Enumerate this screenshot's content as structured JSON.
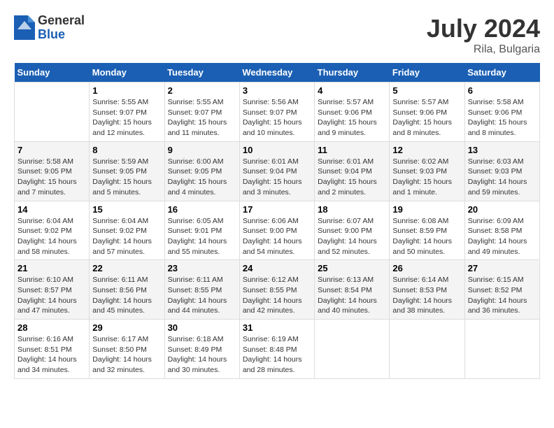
{
  "header": {
    "logo_general": "General",
    "logo_blue": "Blue",
    "month_year": "July 2024",
    "location": "Rila, Bulgaria"
  },
  "days_of_week": [
    "Sunday",
    "Monday",
    "Tuesday",
    "Wednesday",
    "Thursday",
    "Friday",
    "Saturday"
  ],
  "weeks": [
    [
      {
        "day": "",
        "info": ""
      },
      {
        "day": "1",
        "info": "Sunrise: 5:55 AM\nSunset: 9:07 PM\nDaylight: 15 hours\nand 12 minutes."
      },
      {
        "day": "2",
        "info": "Sunrise: 5:55 AM\nSunset: 9:07 PM\nDaylight: 15 hours\nand 11 minutes."
      },
      {
        "day": "3",
        "info": "Sunrise: 5:56 AM\nSunset: 9:07 PM\nDaylight: 15 hours\nand 10 minutes."
      },
      {
        "day": "4",
        "info": "Sunrise: 5:57 AM\nSunset: 9:06 PM\nDaylight: 15 hours\nand 9 minutes."
      },
      {
        "day": "5",
        "info": "Sunrise: 5:57 AM\nSunset: 9:06 PM\nDaylight: 15 hours\nand 8 minutes."
      },
      {
        "day": "6",
        "info": "Sunrise: 5:58 AM\nSunset: 9:06 PM\nDaylight: 15 hours\nand 8 minutes."
      }
    ],
    [
      {
        "day": "7",
        "info": "Sunrise: 5:58 AM\nSunset: 9:05 PM\nDaylight: 15 hours\nand 7 minutes."
      },
      {
        "day": "8",
        "info": "Sunrise: 5:59 AM\nSunset: 9:05 PM\nDaylight: 15 hours\nand 5 minutes."
      },
      {
        "day": "9",
        "info": "Sunrise: 6:00 AM\nSunset: 9:05 PM\nDaylight: 15 hours\nand 4 minutes."
      },
      {
        "day": "10",
        "info": "Sunrise: 6:01 AM\nSunset: 9:04 PM\nDaylight: 15 hours\nand 3 minutes."
      },
      {
        "day": "11",
        "info": "Sunrise: 6:01 AM\nSunset: 9:04 PM\nDaylight: 15 hours\nand 2 minutes."
      },
      {
        "day": "12",
        "info": "Sunrise: 6:02 AM\nSunset: 9:03 PM\nDaylight: 15 hours\nand 1 minute."
      },
      {
        "day": "13",
        "info": "Sunrise: 6:03 AM\nSunset: 9:03 PM\nDaylight: 14 hours\nand 59 minutes."
      }
    ],
    [
      {
        "day": "14",
        "info": "Sunrise: 6:04 AM\nSunset: 9:02 PM\nDaylight: 14 hours\nand 58 minutes."
      },
      {
        "day": "15",
        "info": "Sunrise: 6:04 AM\nSunset: 9:02 PM\nDaylight: 14 hours\nand 57 minutes."
      },
      {
        "day": "16",
        "info": "Sunrise: 6:05 AM\nSunset: 9:01 PM\nDaylight: 14 hours\nand 55 minutes."
      },
      {
        "day": "17",
        "info": "Sunrise: 6:06 AM\nSunset: 9:00 PM\nDaylight: 14 hours\nand 54 minutes."
      },
      {
        "day": "18",
        "info": "Sunrise: 6:07 AM\nSunset: 9:00 PM\nDaylight: 14 hours\nand 52 minutes."
      },
      {
        "day": "19",
        "info": "Sunrise: 6:08 AM\nSunset: 8:59 PM\nDaylight: 14 hours\nand 50 minutes."
      },
      {
        "day": "20",
        "info": "Sunrise: 6:09 AM\nSunset: 8:58 PM\nDaylight: 14 hours\nand 49 minutes."
      }
    ],
    [
      {
        "day": "21",
        "info": "Sunrise: 6:10 AM\nSunset: 8:57 PM\nDaylight: 14 hours\nand 47 minutes."
      },
      {
        "day": "22",
        "info": "Sunrise: 6:11 AM\nSunset: 8:56 PM\nDaylight: 14 hours\nand 45 minutes."
      },
      {
        "day": "23",
        "info": "Sunrise: 6:11 AM\nSunset: 8:55 PM\nDaylight: 14 hours\nand 44 minutes."
      },
      {
        "day": "24",
        "info": "Sunrise: 6:12 AM\nSunset: 8:55 PM\nDaylight: 14 hours\nand 42 minutes."
      },
      {
        "day": "25",
        "info": "Sunrise: 6:13 AM\nSunset: 8:54 PM\nDaylight: 14 hours\nand 40 minutes."
      },
      {
        "day": "26",
        "info": "Sunrise: 6:14 AM\nSunset: 8:53 PM\nDaylight: 14 hours\nand 38 minutes."
      },
      {
        "day": "27",
        "info": "Sunrise: 6:15 AM\nSunset: 8:52 PM\nDaylight: 14 hours\nand 36 minutes."
      }
    ],
    [
      {
        "day": "28",
        "info": "Sunrise: 6:16 AM\nSunset: 8:51 PM\nDaylight: 14 hours\nand 34 minutes."
      },
      {
        "day": "29",
        "info": "Sunrise: 6:17 AM\nSunset: 8:50 PM\nDaylight: 14 hours\nand 32 minutes."
      },
      {
        "day": "30",
        "info": "Sunrise: 6:18 AM\nSunset: 8:49 PM\nDaylight: 14 hours\nand 30 minutes."
      },
      {
        "day": "31",
        "info": "Sunrise: 6:19 AM\nSunset: 8:48 PM\nDaylight: 14 hours\nand 28 minutes."
      },
      {
        "day": "",
        "info": ""
      },
      {
        "day": "",
        "info": ""
      },
      {
        "day": "",
        "info": ""
      }
    ]
  ]
}
